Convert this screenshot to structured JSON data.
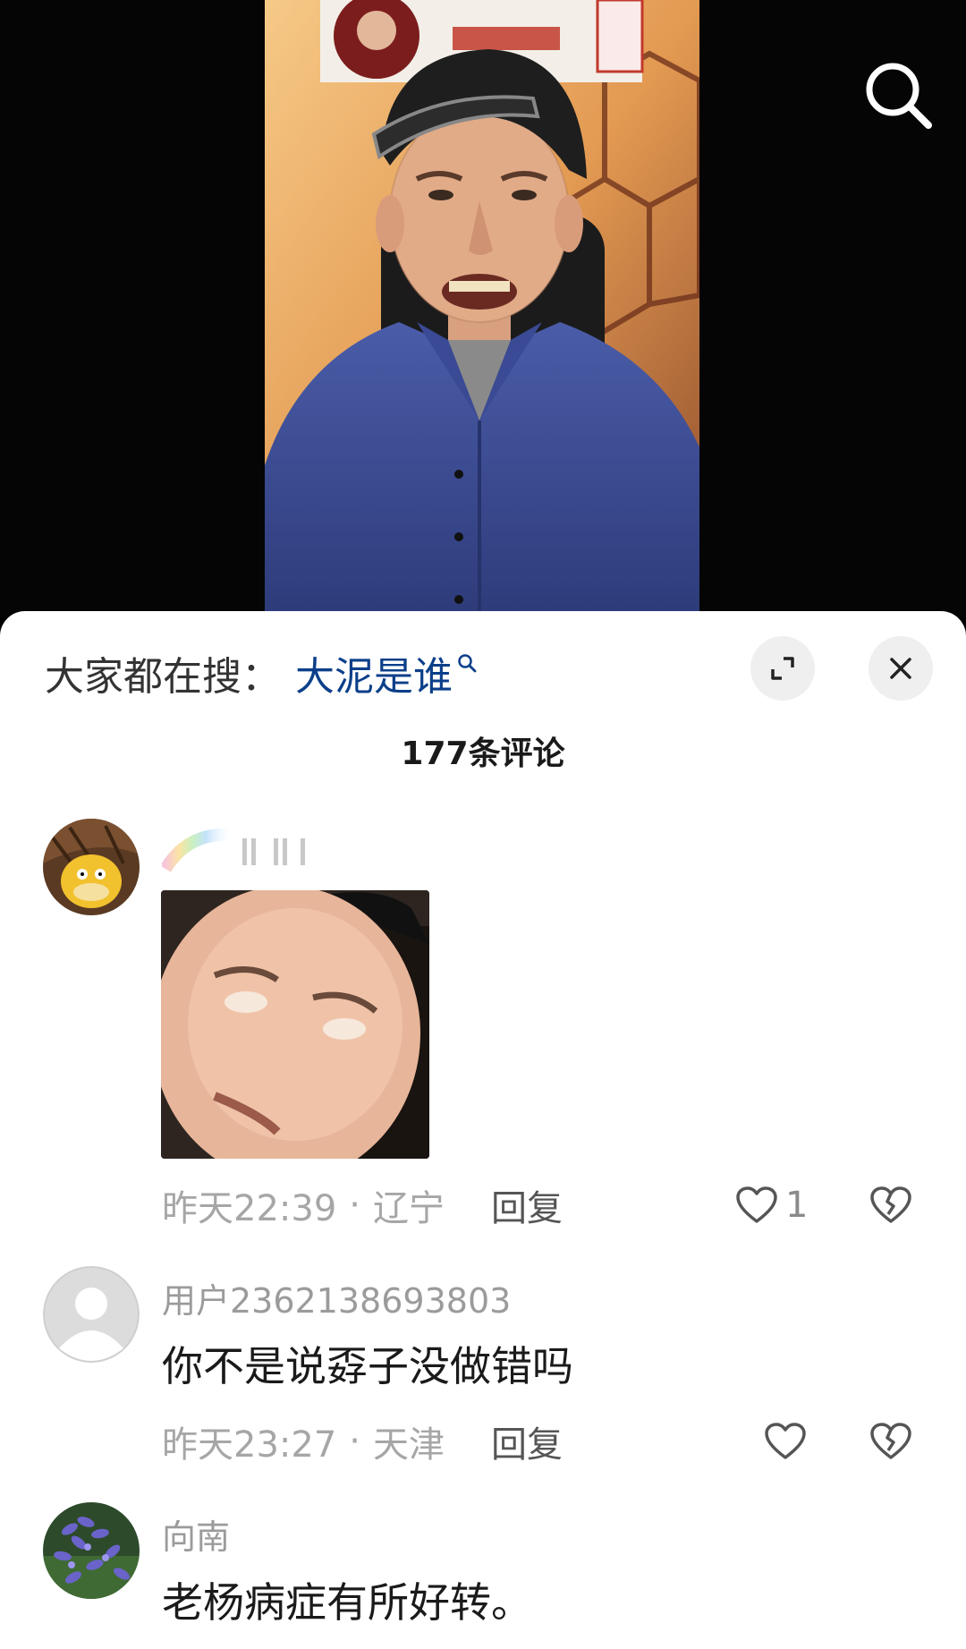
{
  "colors": {
    "sheet_background": "#ffffff",
    "trending_query": "#0b3f8a",
    "meta_text": "#a6a6a6",
    "reply_text": "#555555"
  },
  "header": {
    "search_icon": "search-icon"
  },
  "sheet": {
    "trending_prefix": "大家都在搜：",
    "trending_query": "大泥是谁",
    "expand_icon": "expand-icon",
    "close_icon": "close-icon",
    "comment_count_label": "177条评论"
  },
  "comments": [
    {
      "username": "",
      "text": "",
      "has_image": true,
      "time": "昨天22:39",
      "location": "辽宁",
      "reply_label": "回复",
      "like_count": "1",
      "like_icon": "heart-icon",
      "dislike_icon": "broken-heart-icon"
    },
    {
      "username": "用户2362138693803",
      "text": "你不是说孬子没做错吗",
      "time": "昨天23:27",
      "location": "天津",
      "reply_label": "回复",
      "like_count": "",
      "like_icon": "heart-icon",
      "dislike_icon": "broken-heart-icon"
    },
    {
      "username": "向南",
      "text": "老杨病症有所好转。"
    }
  ],
  "meta_separator": "·"
}
